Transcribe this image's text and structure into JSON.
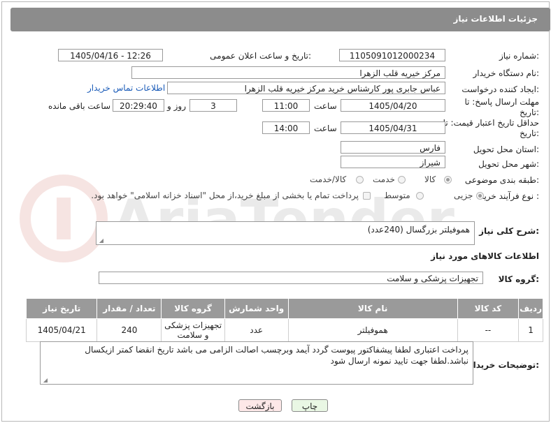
{
  "header": {
    "title": "جزئیات اطلاعات نیاز"
  },
  "fields": {
    "need_number_label": "شماره نیاز:",
    "need_number": "1105091012000234",
    "announce_label": "تاریخ و ساعت اعلان عمومی:",
    "announce_value": "1405/04/16 - 12:26",
    "buyer_org_label": "نام دستگاه خریدار:",
    "buyer_org": "مرکز خیریه قلب الزهرا",
    "creator_label": "ایجاد کننده درخواست:",
    "creator": "عباس جابری پور کارشناس خرید مرکز خیریه قلب الزهرا",
    "contact_link": "اطلاعات تماس خریدار",
    "reply_deadline_label": "مهلت ارسال پاسخ: تا تاریخ:",
    "reply_date": "1405/04/20",
    "time_label": "ساعت",
    "reply_time": "11:00",
    "days_value": "3",
    "days_label": "روز و",
    "remaining_time": "20:29:40",
    "remaining_label": "ساعت باقی مانده",
    "price_deadline_label": "حداقل تاریخ اعتبار قیمت: تا تاریخ:",
    "price_date": "1405/04/31",
    "price_time": "14:00",
    "province_label": "استان محل تحویل:",
    "province": "فارس",
    "city_label": "شهر محل تحویل:",
    "city": "شیراز",
    "category_label": "طبقه بندی موضوعی:",
    "category_options": [
      "کالا",
      "خدمت",
      "کالا/خدمت"
    ],
    "category_selected": "کالا",
    "process_label": "نوع فرآیند خرید :",
    "process_options": [
      "جزیی",
      "متوسط"
    ],
    "process_selected": "جزیی",
    "payment_note": "پرداخت تمام یا بخشی از مبلغ خرید،از محل \"اسناد خزانه اسلامی\" خواهد بود."
  },
  "description": {
    "label": "شرح کلی نیاز:",
    "value": "هموفیلتر بزرگسال (240عدد)"
  },
  "goods_info": {
    "title": "اطلاعات کالاهای مورد نیاز",
    "group_label": "گروه کالا:",
    "group_value": "تجهیزات پزشکی و سلامت"
  },
  "table": {
    "headers": [
      "ردیف",
      "کد کالا",
      "نام کالا",
      "واحد شمارش",
      "گروه کالا",
      "تعداد / مقدار",
      "تاریخ نیاز"
    ],
    "rows": [
      [
        "1",
        "--",
        "هموفیلتر",
        "عدد",
        "تجهیزات پزشکی و سلامت",
        "240",
        "1405/04/21"
      ]
    ]
  },
  "buyer_notes": {
    "label": "توضیحات خریدار:",
    "value": "پرداخت اعتباری لطفا پیشفاکتور پیوست گردد آیمد وبرچسب اصالت الزامی می باشد تاریخ انقضا کمتر ازیکسال نباشد.لطفا جهت تایید نمونه ارسال شود"
  },
  "buttons": {
    "print": "چاپ",
    "back": "بازگشت"
  },
  "colors": {
    "header_bg": "#8c8c8c",
    "link": "#1a5bb8",
    "back_btn_bg": "#fde8e8",
    "print_btn_bg": "#e9f7e4"
  }
}
